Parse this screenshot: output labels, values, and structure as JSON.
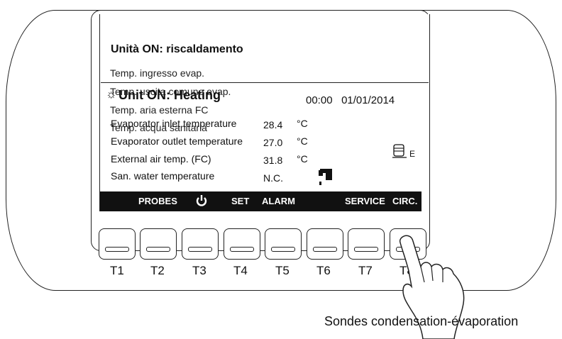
{
  "ghost": {
    "title": "Unità ON: riscaldamento",
    "lines": [
      "Temp. ingresso evap.",
      "Temp. uscita comune evap.",
      "Temp. aria esterna FC",
      "Temp. acqua sanitaria"
    ]
  },
  "screen": {
    "title": "Unit ON: Heating",
    "time": "00:00",
    "date": "01/01/2014",
    "rows": [
      {
        "label": "Evaporator inlet temperature",
        "value": "28.4",
        "unit": "°C"
      },
      {
        "label": "Evaporator outlet temperature",
        "value": "27.0",
        "unit": "°C"
      },
      {
        "label": "External air temp. (FC)",
        "value": "31.8",
        "unit": "°C"
      },
      {
        "label": "San. water temperature",
        "value": "N.C.",
        "unit": ""
      }
    ],
    "pump_letter": "E",
    "function_bar": [
      "PROBES",
      "SET",
      "ALARM",
      "SERVICE",
      "CIRC."
    ]
  },
  "keys": [
    "T1",
    "T2",
    "T3",
    "T4",
    "T5",
    "T6",
    "T7",
    "T8"
  ],
  "callout": "Sondes condensation-évaporation",
  "icons": {
    "sun": "sun-icon",
    "pump": "pump-icon",
    "tap": "tap-icon",
    "power": "power-icon",
    "hand": "pointing-hand-icon"
  }
}
